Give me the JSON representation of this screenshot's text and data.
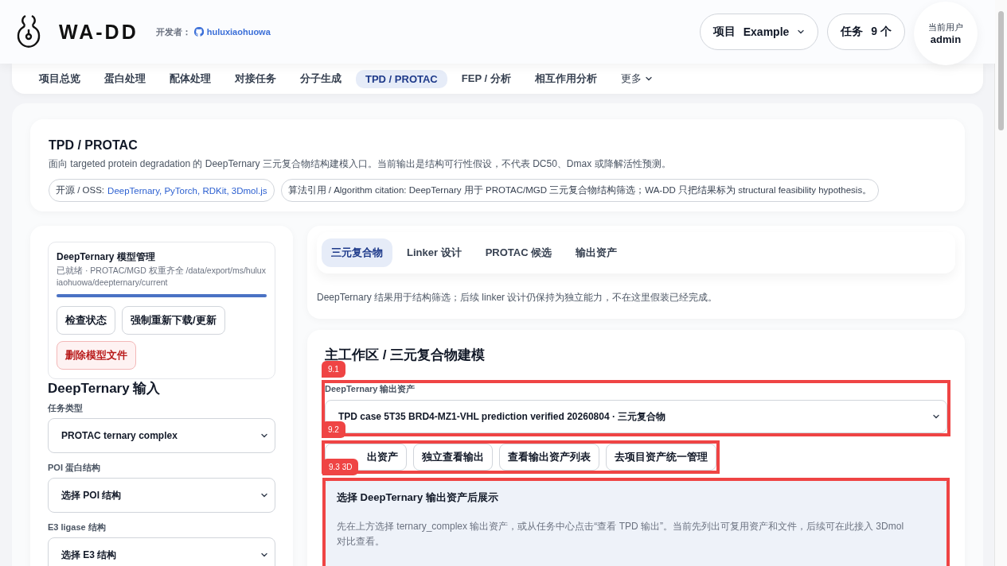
{
  "header": {
    "logo_text": "WA-DD",
    "developer_label": "开发者：",
    "developer_link": "huluxiaohuowa",
    "project": {
      "label": "项目",
      "value": "Example"
    },
    "tasks": {
      "label": "任务",
      "value": "9 个"
    },
    "user": {
      "label": "当前用户",
      "name": "admin"
    }
  },
  "nav": [
    {
      "label": "项目总览",
      "selected": false,
      "dropdown": false
    },
    {
      "label": "蛋白处理",
      "selected": false,
      "dropdown": false
    },
    {
      "label": "配体处理",
      "selected": false,
      "dropdown": false
    },
    {
      "label": "对接任务",
      "selected": false,
      "dropdown": false
    },
    {
      "label": "分子生成",
      "selected": false,
      "dropdown": false
    },
    {
      "label": "TPD / PROTAC",
      "selected": true,
      "dropdown": false
    },
    {
      "label": "FEP / 分析",
      "selected": false,
      "dropdown": false
    },
    {
      "label": "相互作用分析",
      "selected": false,
      "dropdown": false
    },
    {
      "label": "更多",
      "selected": false,
      "dropdown": true
    }
  ],
  "intro": {
    "title": "TPD / PROTAC",
    "description": "面向 targeted protein degradation 的 DeepTernary 三元复合物结构建模入口。当前输出是结构可行性假设，不代表 DC50、Dmax 或降解活性预测。",
    "chips": [
      {
        "kind": "links",
        "label": "开源 / OSS:",
        "link": "DeepTernary, PyTorch, RDKit, 3Dmol.js"
      },
      {
        "kind": "text",
        "label": "算法引用 / Algorithm citation: DeepTernary 用于 PROTAC/MGD 三元复合物结构筛选；WA-DD 只把结果标为 structural feasibility hypothesis。"
      }
    ]
  },
  "model_card": {
    "title": "DeepTernary 模型管理",
    "status": "已就绪 · PROTAC/MGD 权重齐全 /data/export/ms/huluxiaohuowa/deepternary/current",
    "level": 1,
    "buttons": [
      {
        "label": "检查状态",
        "kind": "normal"
      },
      {
        "label": "强制重新下载/更新",
        "kind": "normal"
      },
      {
        "label": "删除模型文件",
        "kind": "danger"
      }
    ]
  },
  "inputs": {
    "title": "DeepTernary 输入",
    "fields": [
      {
        "label": "任务类型",
        "value": "PROTAC ternary complex"
      },
      {
        "label": "POI 蛋白结构",
        "value": "选择 POI 结构"
      },
      {
        "label": "E3 ligase 结构",
        "value": "选择 E3 结构"
      }
    ]
  },
  "tpd_tabs": {
    "tabs": [
      {
        "label": "三元复合物",
        "selected": true
      },
      {
        "label": "Linker 设计",
        "selected": false
      },
      {
        "label": "PROTAC 候选",
        "selected": false
      },
      {
        "label": "输出资产",
        "selected": false
      }
    ],
    "note": "DeepTernary 结果用于结构筛选；后续 linker 设计仍保持为独立能力，不在这里假装已经完成。"
  },
  "workspace": {
    "title": "主工作区 / 三元复合物建模",
    "asset": {
      "annotation": "9.1",
      "label": "DeepTernary 输出资产",
      "value": "TPD case 5T35 BRD4-MZ1-VHL prediction verified 20260804 · 三元复合物"
    },
    "actions": {
      "annotation": "9.2",
      "buttons": [
        "出资产",
        "独立查看输出",
        "查看输出资产列表",
        "去项目资产统一管理"
      ]
    },
    "viewer": {
      "annotation": "9.3 3D",
      "title": "选择 DeepTernary 输出资产后展示",
      "text": "先在上方选择 ternary_complex 输出资产，或从任务中心点击“查看 TPD 输出”。当前先列出可复用资产和文件，后续可在此接入 3Dmol 对比查看。"
    }
  }
}
